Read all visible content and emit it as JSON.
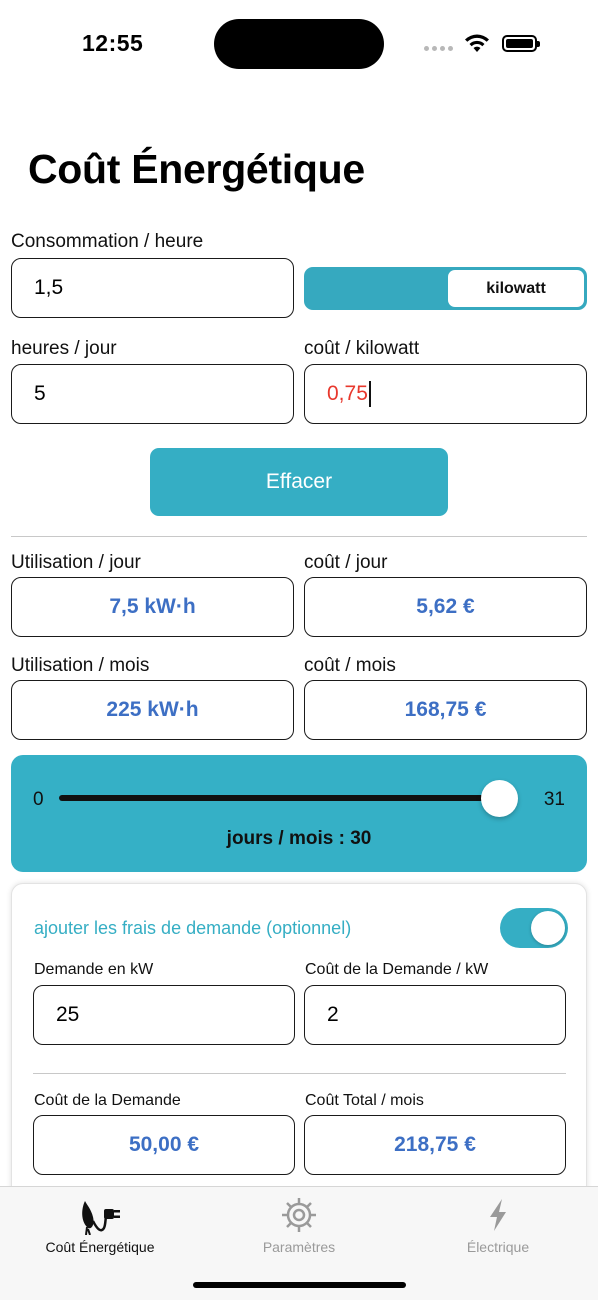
{
  "status": {
    "time": "12:55"
  },
  "title": "Coût Énergétique",
  "inputs": {
    "consumption_label": "Consommation / heure",
    "consumption_value": "1,5",
    "unit_selected": "kilowatt",
    "hours_label": "heures / jour",
    "hours_value": "5",
    "cost_label": "coût / kilowatt",
    "cost_value": "0,75"
  },
  "clear_button": "Effacer",
  "results": {
    "use_day_label": "Utilisation / jour",
    "use_day_value": "7,5 kW·h",
    "cost_day_label": "coût / jour",
    "cost_day_value": "5,62 €",
    "use_month_label": "Utilisation / mois",
    "use_month_value": "225 kW·h",
    "cost_month_label": "coût / mois",
    "cost_month_value": "168,75 €"
  },
  "slider": {
    "min": "0",
    "max": "31",
    "value": 30,
    "caption": "jours / mois :  30"
  },
  "demand": {
    "toggle_label": "ajouter les frais de demande (optionnel)",
    "toggle_on": true,
    "kw_label": "Demande en kW",
    "kw_value": "25",
    "cost_kw_label": "Coût de la Demande / kW",
    "cost_kw_value": "2",
    "demand_cost_label": "Coût de la Demande",
    "demand_cost_value": "50,00 €",
    "total_label": "Coût Total / mois",
    "total_value": "218,75 €"
  },
  "tabs": [
    {
      "label": "Coût Énergétique",
      "icon": "plug-icon",
      "active": true
    },
    {
      "label": "Paramètres",
      "icon": "gear-icon",
      "active": false
    },
    {
      "label": "Électrique",
      "icon": "bolt-icon",
      "active": false
    }
  ],
  "colors": {
    "accent": "#35aec4",
    "result_text": "#3d6fc4",
    "error_text": "#e8382d"
  }
}
